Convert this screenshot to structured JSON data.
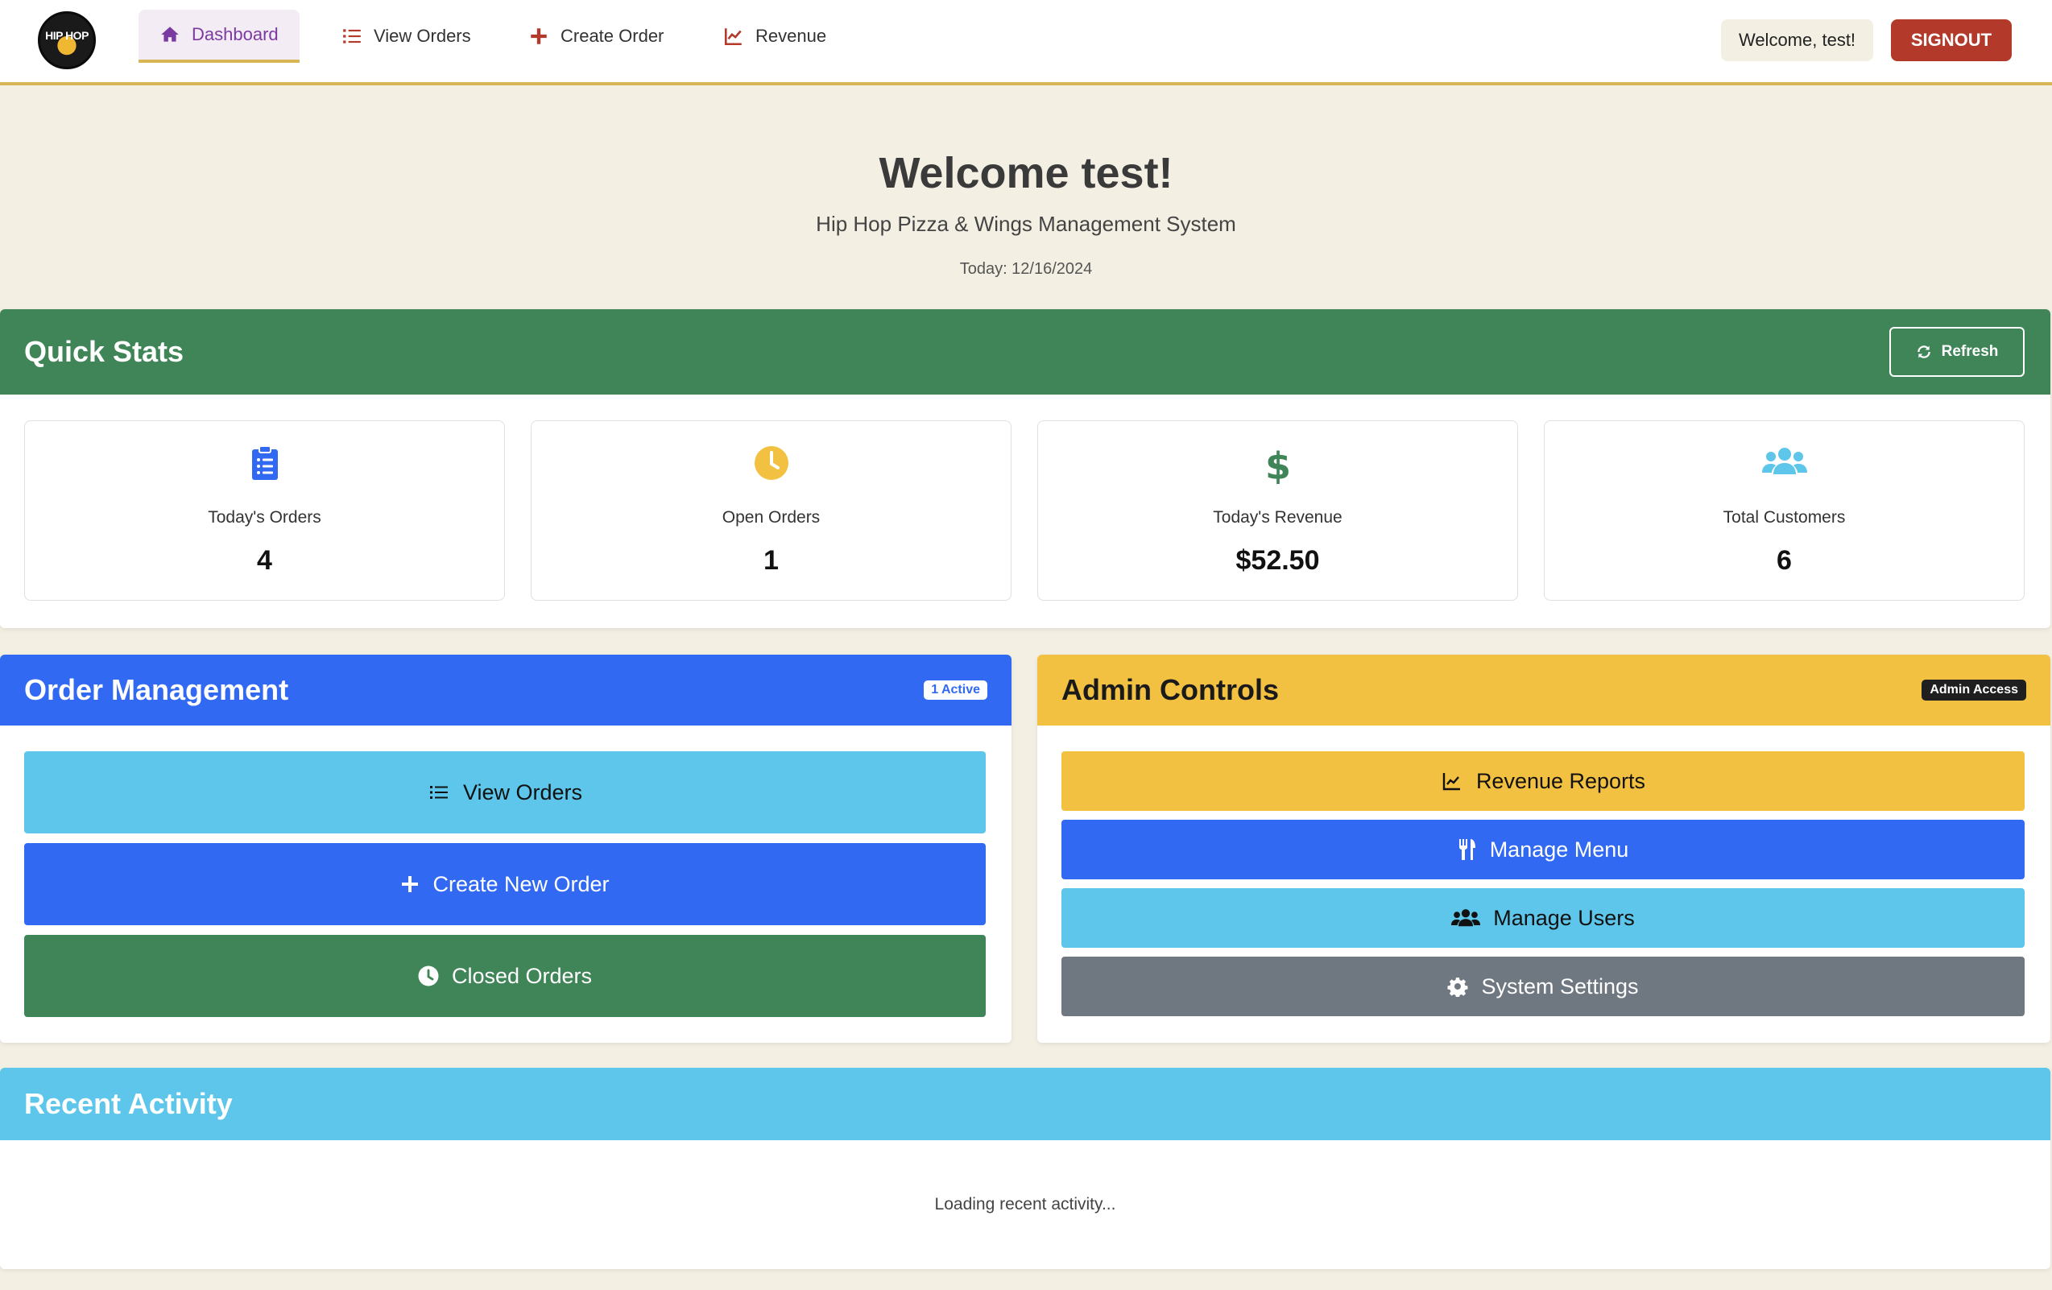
{
  "nav": {
    "logo_text": "HIP HOP",
    "items": [
      {
        "label": "Dashboard",
        "icon": "home-icon",
        "active": true
      },
      {
        "label": "View Orders",
        "icon": "list-icon",
        "active": false
      },
      {
        "label": "Create Order",
        "icon": "plus-icon",
        "active": false
      },
      {
        "label": "Revenue",
        "icon": "chart-line-icon",
        "active": false
      }
    ],
    "welcome": "Welcome, test!",
    "signout": "SIGNOUT"
  },
  "hero": {
    "title": "Welcome test!",
    "subtitle": "Hip Hop Pizza & Wings Management System",
    "date": "Today: 12/16/2024"
  },
  "quick_stats": {
    "title": "Quick Stats",
    "refresh_label": "Refresh",
    "stats": [
      {
        "label": "Today's Orders",
        "value": "4",
        "icon": "clipboard-list-icon",
        "color": "#3169f2"
      },
      {
        "label": "Open Orders",
        "value": "1",
        "icon": "clock-icon",
        "color": "#f2c142"
      },
      {
        "label": "Today's Revenue",
        "value": "$52.50",
        "icon": "dollar-icon",
        "color": "#3f8558"
      },
      {
        "label": "Total Customers",
        "value": "6",
        "icon": "users-icon",
        "color": "#5dc6ea"
      }
    ]
  },
  "order_management": {
    "title": "Order Management",
    "badge": "1 Active",
    "buttons": [
      {
        "label": "View Orders",
        "icon": "list-icon",
        "color": "#5dc6ea"
      },
      {
        "label": "Create New Order",
        "icon": "plus-icon",
        "color": "#3169f2"
      },
      {
        "label": "Closed Orders",
        "icon": "clock-icon",
        "color": "#3f8558"
      }
    ]
  },
  "admin_controls": {
    "title": "Admin Controls",
    "badge": "Admin Access",
    "buttons": [
      {
        "label": "Revenue Reports",
        "icon": "chart-line-icon",
        "color": "#f2c142"
      },
      {
        "label": "Manage Menu",
        "icon": "utensils-icon",
        "color": "#3169f2"
      },
      {
        "label": "Manage Users",
        "icon": "users-icon",
        "color": "#5dc6ea"
      },
      {
        "label": "System Settings",
        "icon": "gear-icon",
        "color": "#6f7780"
      }
    ]
  },
  "recent_activity": {
    "title": "Recent Activity",
    "message": "Loading recent activity..."
  },
  "colors": {
    "green": "#3f8558",
    "blue": "#3169f2",
    "yellow": "#f2c142",
    "cyan": "#5dc6ea",
    "gray": "#6f7780",
    "red": "#b33a2a",
    "gold_border": "#d9b655",
    "background": "#f3efe3"
  }
}
